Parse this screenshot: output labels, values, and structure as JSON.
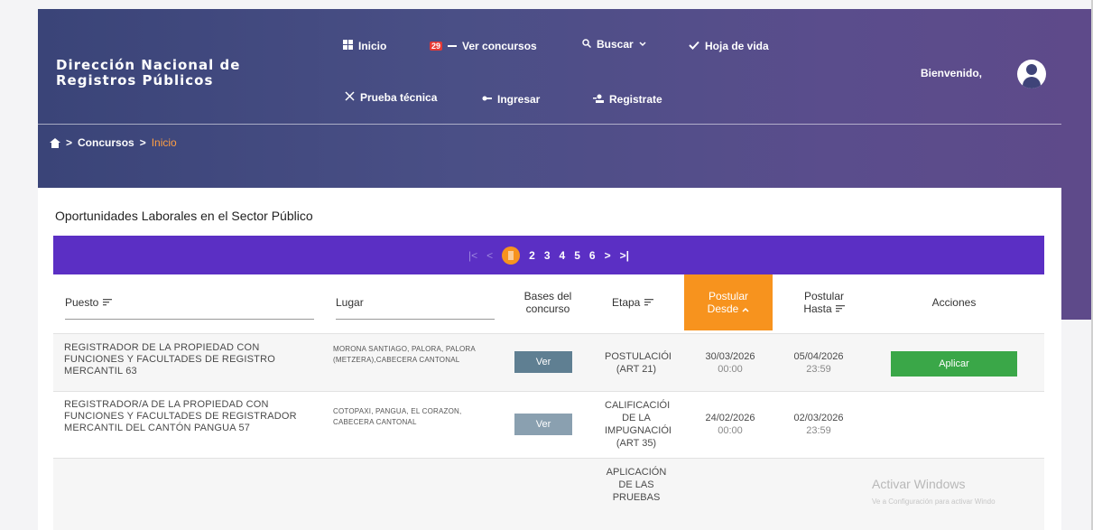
{
  "brand": {
    "line1": "Dirección Nacional de",
    "line2": "Registros Públicos"
  },
  "nav": {
    "inicio": "Inicio",
    "ver_concursos": "Ver concursos",
    "ver_concursos_badge": "29",
    "buscar": "Buscar",
    "hoja_de_vida": "Hoja de vida",
    "prueba_tecnica": "Prueba técnica",
    "ingresar": "Ingresar",
    "registrate": "Registrate",
    "welcome": "Bienvenido,"
  },
  "breadcrumb": {
    "concursos": "Concursos",
    "inicio": "Inicio",
    "sep": ">"
  },
  "card": {
    "title": "Oportunidades Laborales en el Sector Público"
  },
  "pager": {
    "first": "|<",
    "prev": "<",
    "current": "1",
    "pages": [
      "2",
      "3",
      "4",
      "5",
      "6"
    ],
    "next": ">",
    "last": ">|"
  },
  "table": {
    "headers": {
      "puesto": "Puesto",
      "lugar": "Lugar",
      "bases_1": "Bases del",
      "bases_2": "concurso",
      "etapa": "Etapa",
      "desde_1": "Postular",
      "desde_2": "Desde",
      "hasta_1": "Postular",
      "hasta_2": "Hasta",
      "acciones": "Acciones"
    },
    "rows": [
      {
        "puesto": "REGISTRADOR DE LA PROPIEDAD CON FUNCIONES Y FACULTADES DE REGISTRO MERCANTIL 63",
        "lugar": "MORONA SANTIAGO, PALORA, PALORA (METZERA),CABECERA CANTONAL",
        "ver": "Ver",
        "etapa_1": "POSTULACIÓI",
        "etapa_2": "(ART 21)",
        "desde_1": "30/03/2026",
        "desde_2": "00:00",
        "hasta_1": "05/04/2026",
        "hasta_2": "23:59",
        "accion": "Aplicar"
      },
      {
        "puesto": "REGISTRADOR/A DE LA PROPIEDAD CON FUNCIONES Y FACULTADES DE REGISTRADOR MERCANTIL DEL CANTÓN PANGUA 57",
        "lugar": "COTOPAXI, PANGUA, EL CORAZON, CABECERA CANTONAL",
        "ver": "Ver",
        "etapa_1": "CALIFICACIÓI",
        "etapa_2": "DE LA",
        "etapa_3": "IMPUGNACIÓI",
        "etapa_4": "(ART 35)",
        "desde_1": "24/02/2026",
        "desde_2": "00:00",
        "hasta_1": "02/03/2026",
        "hasta_2": "23:59"
      },
      {
        "etapa_1": "APLICACIÓN",
        "etapa_2": "DE LAS",
        "etapa_3": "PRUEBAS"
      }
    ]
  },
  "windows_activation": {
    "title": "Activar Windows",
    "subtitle": "Ve a Configuración para activar Windo"
  },
  "colors": {
    "header_start": "#3a4478",
    "header_end": "#5e4a8a",
    "pager_bg": "#5b2fc4",
    "accent_orange": "#f7931e",
    "aplicar_green": "#3aa748",
    "ver_button": "#5f7f92"
  },
  "icons": [
    "grid-icon",
    "ticket-icon",
    "search-icon",
    "check-icon",
    "tools-icon",
    "login-icon",
    "add-user-icon",
    "user-avatar-icon",
    "home-icon",
    "sort-icon",
    "sort-up-icon"
  ]
}
